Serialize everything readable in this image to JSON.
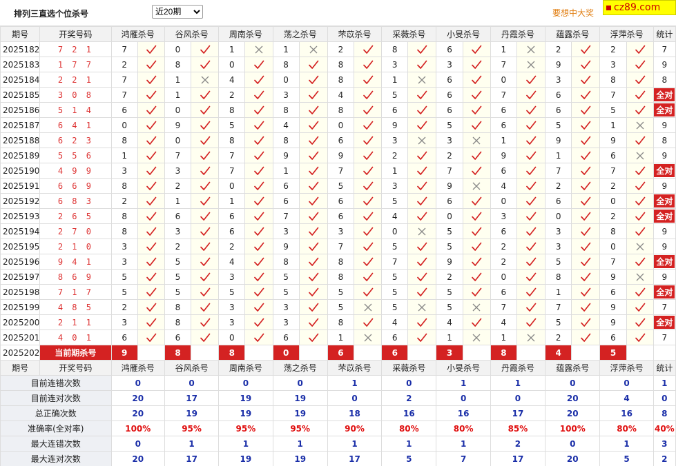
{
  "header": {
    "title": "排列三直选个位杀号",
    "period_selected": "近20期",
    "period_options": [
      "近20期"
    ],
    "slogan": "要想中大奖",
    "site_badge": "cz89.com"
  },
  "columns": {
    "issue": "期号",
    "code": "开奖号码",
    "experts": [
      "鸿雁杀号",
      "谷风杀号",
      "周南杀号",
      "荡之杀号",
      "芣苡杀号",
      "采薇杀号",
      "小旻杀号",
      "丹霞杀号",
      "蕴露杀号",
      "浮萍杀号"
    ],
    "total": "统计"
  },
  "rows": [
    {
      "issue": "2025182",
      "code": "7 2 1",
      "kills": [
        7,
        0,
        1,
        1,
        2,
        8,
        6,
        1,
        2,
        2
      ],
      "hits": [
        1,
        1,
        0,
        0,
        1,
        1,
        1,
        0,
        1,
        1
      ],
      "total": "7"
    },
    {
      "issue": "2025183",
      "code": "1 7 7",
      "kills": [
        2,
        8,
        0,
        8,
        8,
        3,
        3,
        7,
        9,
        3
      ],
      "hits": [
        1,
        1,
        1,
        1,
        1,
        1,
        1,
        0,
        1,
        1
      ],
      "total": "9"
    },
    {
      "issue": "2025184",
      "code": "2 2 1",
      "kills": [
        7,
        1,
        4,
        0,
        8,
        1,
        6,
        0,
        3,
        8
      ],
      "hits": [
        1,
        0,
        1,
        1,
        1,
        0,
        1,
        1,
        1,
        1
      ],
      "total": "8"
    },
    {
      "issue": "2025185",
      "code": "3 0 8",
      "kills": [
        7,
        1,
        2,
        3,
        4,
        5,
        6,
        7,
        6,
        7
      ],
      "hits": [
        1,
        1,
        1,
        1,
        1,
        1,
        1,
        1,
        1,
        1
      ],
      "total": "全对"
    },
    {
      "issue": "2025186",
      "code": "5 1 4",
      "kills": [
        6,
        0,
        8,
        8,
        8,
        6,
        6,
        6,
        6,
        5
      ],
      "hits": [
        1,
        1,
        1,
        1,
        1,
        1,
        1,
        1,
        1,
        1
      ],
      "total": "全对"
    },
    {
      "issue": "2025187",
      "code": "6 4 1",
      "kills": [
        0,
        9,
        5,
        4,
        0,
        9,
        5,
        6,
        5,
        1
      ],
      "hits": [
        1,
        1,
        1,
        1,
        1,
        1,
        1,
        1,
        1,
        0
      ],
      "total": "9"
    },
    {
      "issue": "2025188",
      "code": "6 2 3",
      "kills": [
        8,
        0,
        8,
        8,
        6,
        3,
        3,
        1,
        9,
        9
      ],
      "hits": [
        1,
        1,
        1,
        1,
        1,
        0,
        0,
        1,
        1,
        1
      ],
      "total": "8"
    },
    {
      "issue": "2025189",
      "code": "5 5 6",
      "kills": [
        1,
        7,
        7,
        9,
        9,
        2,
        2,
        9,
        1,
        6
      ],
      "hits": [
        1,
        1,
        1,
        1,
        1,
        1,
        1,
        1,
        1,
        0
      ],
      "total": "9"
    },
    {
      "issue": "2025190",
      "code": "4 9 9",
      "kills": [
        3,
        3,
        7,
        1,
        7,
        1,
        7,
        6,
        7,
        7
      ],
      "hits": [
        1,
        1,
        1,
        1,
        1,
        1,
        1,
        1,
        1,
        1
      ],
      "total": "全对"
    },
    {
      "issue": "2025191",
      "code": "6 6 9",
      "kills": [
        8,
        2,
        0,
        6,
        5,
        3,
        9,
        4,
        2,
        2
      ],
      "hits": [
        1,
        1,
        1,
        1,
        1,
        1,
        0,
        1,
        1,
        1
      ],
      "total": "9"
    },
    {
      "issue": "2025192",
      "code": "6 8 3",
      "kills": [
        2,
        1,
        1,
        6,
        6,
        5,
        6,
        0,
        6,
        0
      ],
      "hits": [
        1,
        1,
        1,
        1,
        1,
        1,
        1,
        1,
        1,
        1
      ],
      "total": "全对"
    },
    {
      "issue": "2025193",
      "code": "2 6 5",
      "kills": [
        8,
        6,
        6,
        7,
        6,
        4,
        0,
        3,
        0,
        2
      ],
      "hits": [
        1,
        1,
        1,
        1,
        1,
        1,
        1,
        1,
        1,
        1
      ],
      "total": "全对"
    },
    {
      "issue": "2025194",
      "code": "2 7 0",
      "kills": [
        8,
        3,
        6,
        3,
        3,
        0,
        5,
        6,
        3,
        8
      ],
      "hits": [
        1,
        1,
        1,
        1,
        1,
        0,
        1,
        1,
        1,
        1
      ],
      "total": "9"
    },
    {
      "issue": "2025195",
      "code": "2 1 0",
      "kills": [
        3,
        2,
        2,
        9,
        7,
        5,
        5,
        2,
        3,
        0
      ],
      "hits": [
        1,
        1,
        1,
        1,
        1,
        1,
        1,
        1,
        1,
        0
      ],
      "total": "9"
    },
    {
      "issue": "2025196",
      "code": "9 4 1",
      "kills": [
        3,
        5,
        4,
        8,
        8,
        7,
        9,
        2,
        5,
        7
      ],
      "hits": [
        1,
        1,
        1,
        1,
        1,
        1,
        1,
        1,
        1,
        1
      ],
      "total": "全对"
    },
    {
      "issue": "2025197",
      "code": "8 6 9",
      "kills": [
        5,
        5,
        3,
        5,
        8,
        5,
        2,
        0,
        8,
        9
      ],
      "hits": [
        1,
        1,
        1,
        1,
        1,
        1,
        1,
        1,
        1,
        0
      ],
      "total": "9"
    },
    {
      "issue": "2025198",
      "code": "7 1 7",
      "kills": [
        5,
        5,
        5,
        5,
        5,
        5,
        5,
        6,
        1,
        6
      ],
      "hits": [
        1,
        1,
        1,
        1,
        1,
        1,
        1,
        1,
        1,
        1
      ],
      "total": "全对"
    },
    {
      "issue": "2025199",
      "code": "4 8 5",
      "kills": [
        2,
        8,
        3,
        3,
        5,
        5,
        5,
        7,
        7,
        9
      ],
      "hits": [
        1,
        1,
        1,
        1,
        0,
        0,
        0,
        1,
        1,
        1
      ],
      "total": "7"
    },
    {
      "issue": "2025200",
      "code": "2 1 1",
      "kills": [
        3,
        8,
        3,
        3,
        8,
        4,
        4,
        4,
        5,
        9
      ],
      "hits": [
        1,
        1,
        1,
        1,
        1,
        1,
        1,
        1,
        1,
        1
      ],
      "total": "全对"
    },
    {
      "issue": "2025201",
      "code": "4 0 1",
      "kills": [
        6,
        6,
        0,
        6,
        1,
        6,
        1,
        1,
        2,
        6
      ],
      "hits": [
        1,
        1,
        1,
        1,
        0,
        1,
        0,
        0,
        1,
        1
      ],
      "total": "7"
    }
  ],
  "current": {
    "issue": "2025202",
    "label": "当前期杀号",
    "kills": [
      9,
      8,
      8,
      0,
      6,
      6,
      3,
      8,
      4,
      5
    ]
  },
  "stats": [
    {
      "label": "目前连错次数",
      "values": [
        "0",
        "0",
        "0",
        "0",
        "1",
        "0",
        "1",
        "1",
        "0",
        "0"
      ],
      "total": "1"
    },
    {
      "label": "目前连对次数",
      "values": [
        "20",
        "17",
        "19",
        "19",
        "0",
        "2",
        "0",
        "0",
        "20",
        "4"
      ],
      "total": "0"
    },
    {
      "label": "总正确次数",
      "values": [
        "20",
        "19",
        "19",
        "19",
        "18",
        "16",
        "16",
        "17",
        "20",
        "16"
      ],
      "total": "8"
    },
    {
      "label": "准确率(全对率)",
      "values": [
        "100%",
        "95%",
        "95%",
        "95%",
        "90%",
        "80%",
        "80%",
        "85%",
        "100%",
        "80%"
      ],
      "total": "40%"
    },
    {
      "label": "最大连错次数",
      "values": [
        "0",
        "1",
        "1",
        "1",
        "1",
        "1",
        "1",
        "2",
        "0",
        "1"
      ],
      "total": "3"
    },
    {
      "label": "最大连对次数",
      "values": [
        "20",
        "17",
        "19",
        "19",
        "17",
        "5",
        "7",
        "17",
        "20",
        "5"
      ],
      "total": "2"
    }
  ],
  "colors": {
    "correct": "#d42222",
    "wrong": "#888888",
    "current_bg": "#d42222",
    "stat_value": "#1a2ea8",
    "stat_pct": "#e01010",
    "accent": "#e07d10"
  },
  "icons": {
    "correct": "check-icon",
    "wrong": "cross-icon"
  }
}
